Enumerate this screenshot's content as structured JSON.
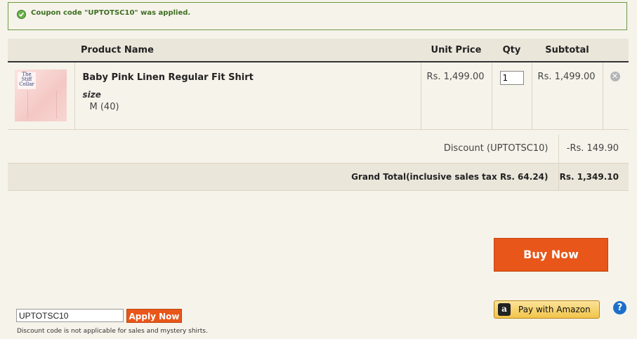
{
  "notice": {
    "message": "Coupon code \"UPTOTSC10\" was applied."
  },
  "table": {
    "headers": {
      "product": "Product Name",
      "unit_price": "Unit Price",
      "qty": "Qty",
      "subtotal": "Subtotal"
    }
  },
  "item": {
    "thumb_brand": "The Stiff Collar",
    "name": "Baby Pink Linen Regular Fit Shirt",
    "option_label": "size",
    "option_value": "M (40)",
    "unit_price": "Rs. 1,499.00",
    "qty": "1",
    "subtotal": "Rs. 1,499.00",
    "remove_glyph": "✕"
  },
  "totals": {
    "discount_label": "Discount (UPTOTSC10)",
    "discount_value": "-Rs. 149.90",
    "grand_label": "Grand Total(inclusive sales tax Rs. 64.24)",
    "grand_value": "Rs. 1,349.10"
  },
  "actions": {
    "buy_now": "Buy Now",
    "pay_amazon": "Pay with Amazon",
    "amazon_glyph": "a",
    "help_glyph": "?"
  },
  "coupon": {
    "value": "UPTOTSC10",
    "apply_label": "Apply Now",
    "note": "Discount code is not applicable for sales and mystery shirts."
  },
  "colors": {
    "accent": "#e8561a",
    "success": "#3d6e22",
    "background": "#f6f3ea",
    "header_bg": "#ebe6da",
    "help": "#1b6fc9"
  }
}
